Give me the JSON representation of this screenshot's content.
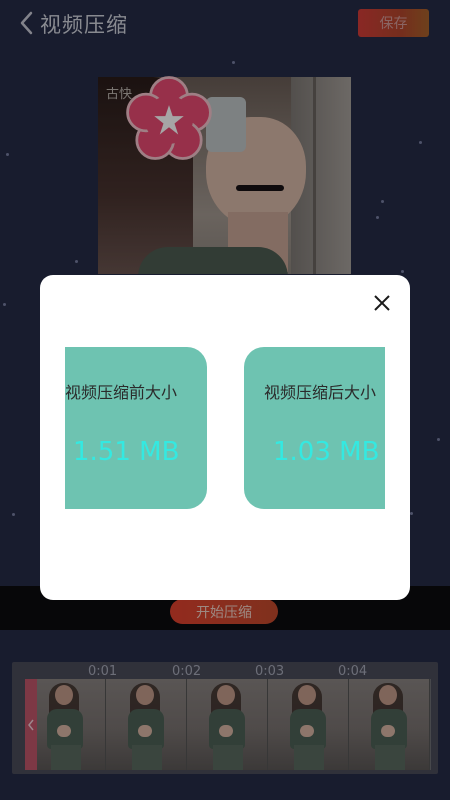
{
  "header": {
    "title": "视频压缩",
    "save_label": "保存"
  },
  "preview": {
    "watermark_text": "古快"
  },
  "actions": {
    "start_label": "开始压缩"
  },
  "timeline": {
    "ticks": [
      "0:01",
      "0:02",
      "0:03",
      "0:04"
    ],
    "frame_count": 5
  },
  "dialog": {
    "before": {
      "label": "视频压缩前大小",
      "value": "1.51 MB"
    },
    "after": {
      "label": "视频压缩后大小",
      "value": "1.03 MB"
    }
  },
  "colors": {
    "background": "#262b48",
    "accent": "#e2422f",
    "card": "#6ec3b1",
    "value_text": "#34e9e1"
  },
  "icons": {
    "back": "chevron-left-icon",
    "close": "close-icon",
    "sticker": "flower-sticker-icon",
    "handle": "chevron-left-icon"
  }
}
